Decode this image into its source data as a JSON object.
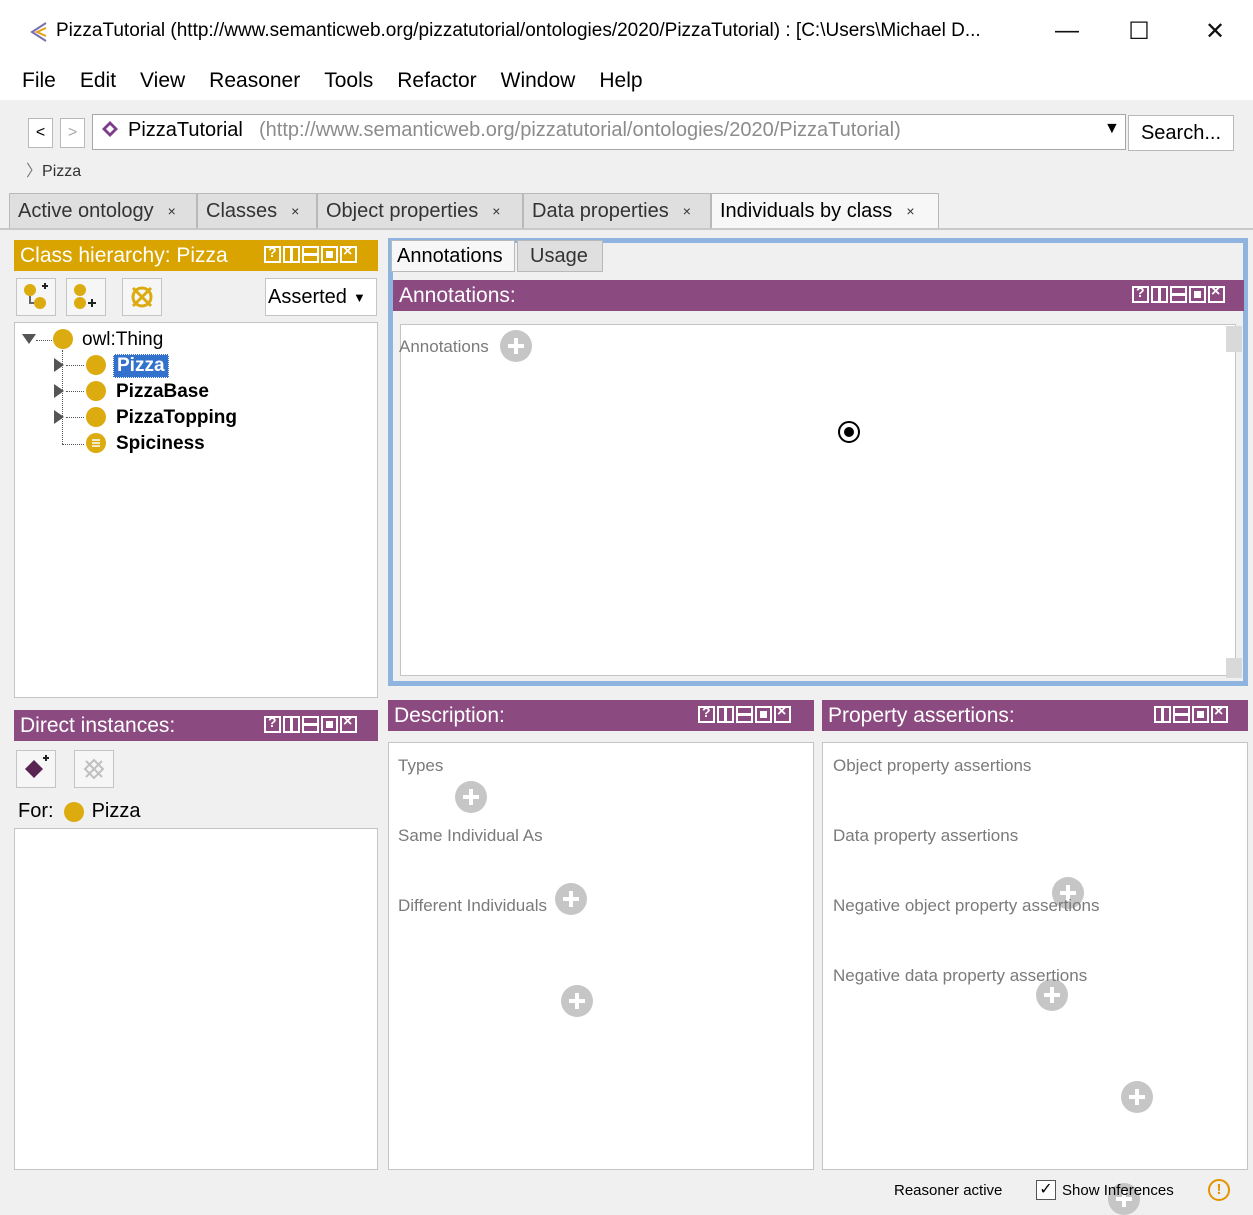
{
  "titlebar": {
    "title": "PizzaTutorial (http://www.semanticweb.org/pizzatutorial/ontologies/2020/PizzaTutorial) : [C:\\Users\\Michael D...",
    "minimize": "—",
    "maximize": "☐",
    "close": "✕"
  },
  "menu": [
    "File",
    "Edit",
    "View",
    "Reasoner",
    "Tools",
    "Refactor",
    "Window",
    "Help"
  ],
  "nav": {
    "back": "<",
    "forward": ">",
    "ontology_name": "PizzaTutorial",
    "ontology_iri": "(http://www.semanticweb.org/pizzatutorial/ontologies/2020/PizzaTutorial)",
    "search_label": "Search...",
    "breadcrumb": "Pizza"
  },
  "tabs": [
    {
      "label": "Active ontology"
    },
    {
      "label": "Classes"
    },
    {
      "label": "Object properties"
    },
    {
      "label": "Data properties"
    },
    {
      "label": "Individuals by class"
    }
  ],
  "class_hierarchy": {
    "title": "Class hierarchy: Pizza",
    "mode": "Asserted",
    "root": "owl:Thing",
    "items": [
      "Pizza",
      "PizzaBase",
      "PizzaTopping",
      "Spiciness"
    ]
  },
  "direct_instances": {
    "title": "Direct instances:",
    "for_label": "For:",
    "for_class": "Pizza"
  },
  "annotations_view": {
    "tabs": [
      "Annotations",
      "Usage"
    ],
    "title": "Annotations:",
    "section": "Annotations"
  },
  "description": {
    "title": "Description:",
    "sections": [
      "Types",
      "Same Individual As",
      "Different Individuals"
    ]
  },
  "property_assertions": {
    "title": "Property assertions:",
    "sections": [
      "Object property assertions",
      "Data property assertions",
      "Negative object property assertions",
      "Negative data property assertions"
    ]
  },
  "status": {
    "reasoner": "Reasoner active",
    "show_inferences": "Show Inferences",
    "warning": "!"
  },
  "colors": {
    "class_header": "#d9a400",
    "individual_header": "#8c4b80",
    "selection": "#3372cc",
    "class_icon": "#dcab10"
  }
}
